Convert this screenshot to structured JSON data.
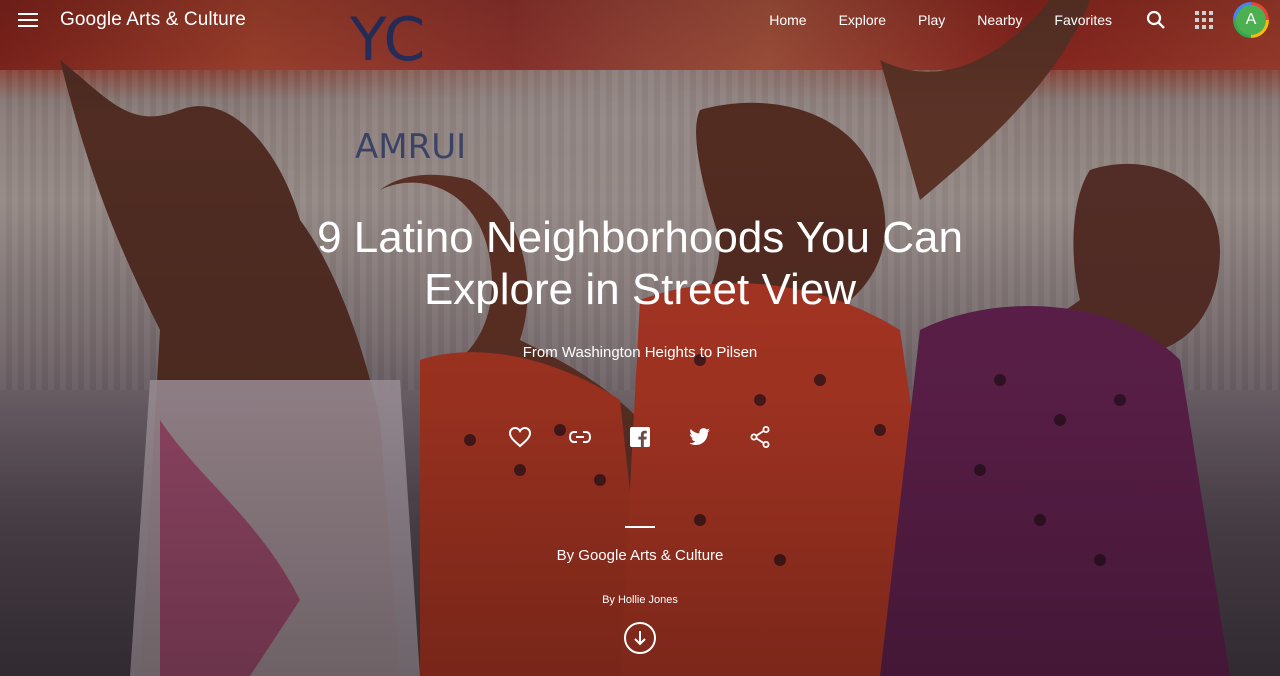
{
  "header": {
    "logo_text": "Google Arts & Culture",
    "nav": [
      {
        "label": "Home"
      },
      {
        "label": "Explore"
      },
      {
        "label": "Play"
      },
      {
        "label": "Nearby"
      },
      {
        "label": "Favorites"
      }
    ],
    "avatar_initial": "A",
    "icons": [
      "menu-icon",
      "search-icon",
      "apps-grid-icon"
    ]
  },
  "story": {
    "title": "9 Latino Neighborhoods You Can Explore in Street View",
    "subtitle": "From Washington Heights to Pilsen",
    "actions": [
      "favorite-heart-icon",
      "copy-link-icon",
      "facebook-icon",
      "twitter-icon",
      "share-icon"
    ],
    "by_org": "By Google Arts & Culture",
    "by_author": "By Hollie Jones",
    "scroll_icon": "arrow-down-circle-icon"
  },
  "colors": {
    "text": "#ffffff",
    "avatar_bg": "#4caf50"
  }
}
